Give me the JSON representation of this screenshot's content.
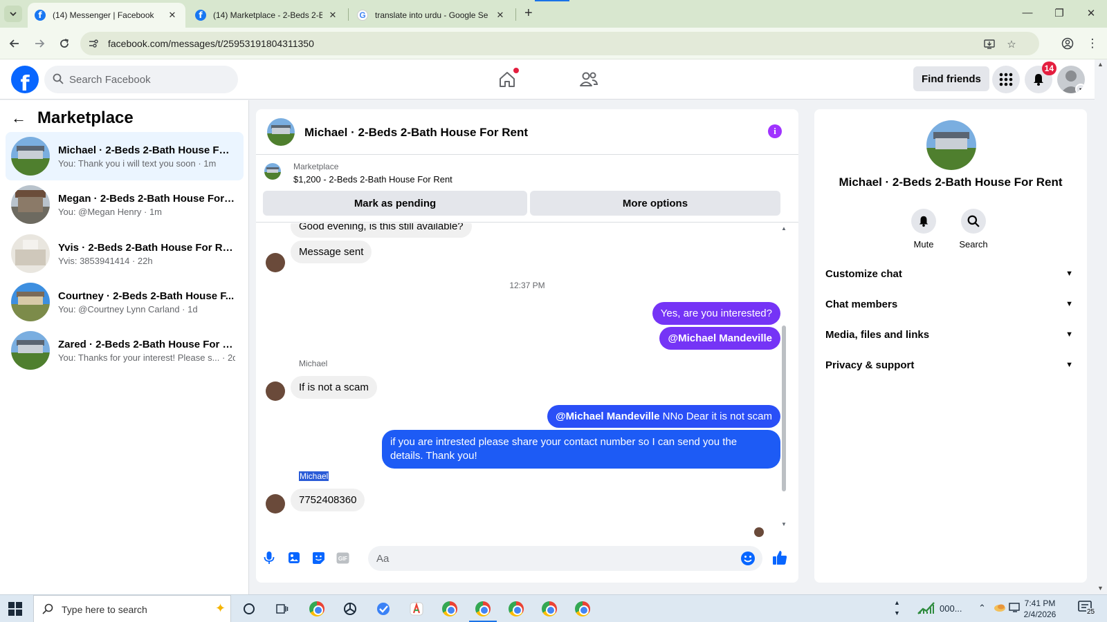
{
  "browser": {
    "tabs": [
      {
        "title": "(14) Messenger | Facebook",
        "favicon": "facebook-icon",
        "active": true
      },
      {
        "title": "(14) Marketplace - 2-Beds 2-Ba",
        "favicon": "facebook-icon",
        "active": false
      },
      {
        "title": "translate into urdu - Google Se",
        "favicon": "google-icon",
        "active": false
      }
    ],
    "url": "facebook.com/messages/t/25953191804311350"
  },
  "header": {
    "search_placeholder": "Search Facebook",
    "find_friends": "Find friends",
    "notification_count": "14"
  },
  "sidebar": {
    "title": "Marketplace",
    "conversations": [
      {
        "name": "Michael · 2-Beds 2-Bath House For...",
        "preview": "You: Thank you i will text you soon · 1m",
        "selected": true
      },
      {
        "name": "Megan · 2-Beds 2-Bath House For ...",
        "preview": "You: @Megan Henry · 1m",
        "selected": false
      },
      {
        "name": "Yvis · 2-Beds 2-Bath House For Rent",
        "preview": "Yvis: 3853941414 · 22h",
        "selected": false
      },
      {
        "name": "Courtney · 2-Beds 2-Bath House F...",
        "preview": "You: @Courtney Lynn Carland · 1d",
        "selected": false
      },
      {
        "name": "Zared · 2-Beds 2-Bath House For R...",
        "preview": "You: Thanks for your interest! Please s... · 2d",
        "selected": false
      }
    ]
  },
  "chat": {
    "title": "Michael · 2-Beds 2-Bath House For Rent",
    "marketplace_label": "Marketplace",
    "listing": "$1,200 - 2-Beds 2-Bath House For Rent",
    "mark_pending": "Mark as pending",
    "more_options": "More options",
    "messages": {
      "m1": "Good evening, is this still available?",
      "m2": "Message sent",
      "time": "12:37 PM",
      "m3": "Yes, are you interested?",
      "m4": "@Michael Mandeville",
      "sender1": "Michael",
      "m5": "If is not a scam",
      "m6_mention": "@Michael Mandeville",
      "m6_text": " NNo Dear it is not scam",
      "m7": "if you are intrested please share your contact number so I can send you the details. Thank you!",
      "sender2": "Michael",
      "m8": "7752408360"
    },
    "composer_placeholder": "Aa"
  },
  "info_panel": {
    "title": "Michael · 2-Beds 2-Bath House For Rent",
    "mute": "Mute",
    "search": "Search",
    "sections": [
      "Customize chat",
      "Chat members",
      "Media, files and links",
      "Privacy & support"
    ]
  },
  "taskbar": {
    "search_placeholder": "Type here to search",
    "tray_text": "000...",
    "time": "7:41 PM",
    "date": "2/4/2026",
    "notification_count": "25"
  },
  "colors": {
    "accent_purple": "#7534f6",
    "accent_blue": "#2a4ff7",
    "fb_blue": "#0866ff"
  }
}
